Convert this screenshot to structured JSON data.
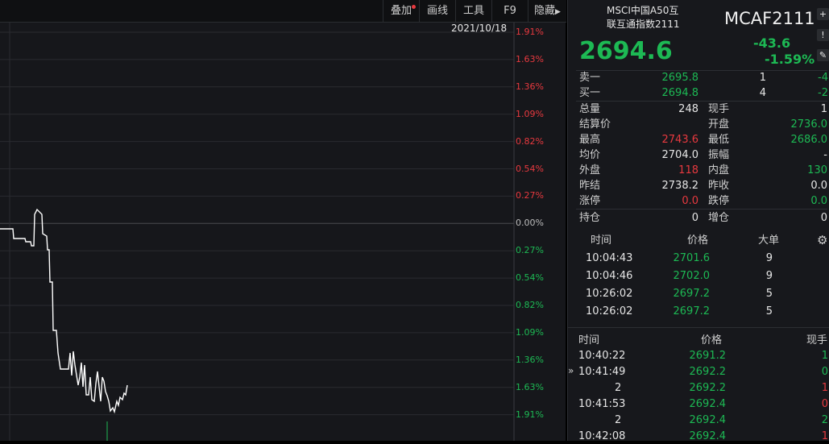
{
  "toolbar": {
    "overlay_label": "叠加",
    "draw_label": "画线",
    "tools_label": "工具",
    "f9_label": "F9",
    "hide_label": "隐藏"
  },
  "chart": {
    "date": "2021/10/18",
    "pct_labels": [
      {
        "text": "1.91%",
        "tone": "red"
      },
      {
        "text": "1.63%",
        "tone": "red"
      },
      {
        "text": "1.36%",
        "tone": "red"
      },
      {
        "text": "1.09%",
        "tone": "red"
      },
      {
        "text": "0.82%",
        "tone": "red"
      },
      {
        "text": "0.54%",
        "tone": "red"
      },
      {
        "text": "0.27%",
        "tone": "red"
      },
      {
        "text": "0.00%",
        "tone": "gray"
      },
      {
        "text": "0.27%",
        "tone": "green"
      },
      {
        "text": "0.54%",
        "tone": "green"
      },
      {
        "text": "0.82%",
        "tone": "green"
      },
      {
        "text": "1.09%",
        "tone": "green"
      },
      {
        "text": "1.36%",
        "tone": "green"
      },
      {
        "text": "1.63%",
        "tone": "green"
      },
      {
        "text": "1.91%",
        "tone": "green"
      }
    ],
    "colors": {
      "up": "#e8393f",
      "down": "#1db954",
      "line": "#ffffff",
      "grid": "#2a2b30"
    }
  },
  "quote": {
    "name_line1": "MSCI中国A50互",
    "name_line2": "联互通指数2111",
    "code": "MCAF2111",
    "price": "2694.6",
    "change": "-43.6",
    "change_pct": "-1.59%"
  },
  "book": {
    "ask_label": "卖一",
    "ask_price": "2695.8",
    "ask_vol": "1",
    "ask_chg": "-4",
    "bid_label": "买一",
    "bid_price": "2694.8",
    "bid_vol": "4",
    "bid_chg": "-2"
  },
  "stats": {
    "total_vol_label": "总量",
    "total_vol": "248",
    "cur_hand_label": "现手",
    "cur_hand": "1",
    "settle_label": "结算价",
    "settle": "",
    "open_label": "开盘",
    "open": "2736.0",
    "high_label": "最高",
    "high": "2743.6",
    "low_label": "最低",
    "low": "2686.0",
    "avg_label": "均价",
    "avg": "2704.0",
    "amp_label": "振幅",
    "amp": "-",
    "outer_label": "外盘",
    "outer": "118",
    "inner_label": "内盘",
    "inner": "130",
    "prev_settle_label": "昨结",
    "prev_settle": "2738.2",
    "prev_close_label": "昨收",
    "prev_close": "0.0",
    "limit_up_label": "涨停",
    "limit_up": "0.0",
    "limit_down_label": "跌停",
    "limit_down": "0.0",
    "oi_label": "持仓",
    "oi": "0",
    "oi_chg_label": "增仓",
    "oi_chg": "0"
  },
  "big_orders": {
    "headers": {
      "time": "时间",
      "price": "价格",
      "size": "大单"
    },
    "rows": [
      {
        "time": "10:04:43",
        "price": "2701.6",
        "size": "9"
      },
      {
        "time": "10:04:46",
        "price": "2702.0",
        "size": "9"
      },
      {
        "time": "10:26:02",
        "price": "2697.2",
        "size": "5"
      },
      {
        "time": "10:26:02",
        "price": "2697.2",
        "size": "5"
      }
    ]
  },
  "ticks": {
    "headers": {
      "time": "时间",
      "price": "价格",
      "hand": "现手"
    },
    "rows": [
      {
        "time": "10:40:22",
        "price": "2691.2",
        "hand": "1",
        "tone": "green"
      },
      {
        "time": "10:41:49",
        "price": "2692.2",
        "hand": "0",
        "tone": "green"
      },
      {
        "time": "2",
        "price": "2692.2",
        "hand": "1",
        "tone": "red"
      },
      {
        "time": "10:41:53",
        "price": "2692.4",
        "hand": "0",
        "tone": "red"
      },
      {
        "time": "2",
        "price": "2692.4",
        "hand": "2",
        "tone": "green"
      },
      {
        "time": "10:42:08",
        "price": "2692.4",
        "hand": "1",
        "tone": "red"
      }
    ]
  }
}
